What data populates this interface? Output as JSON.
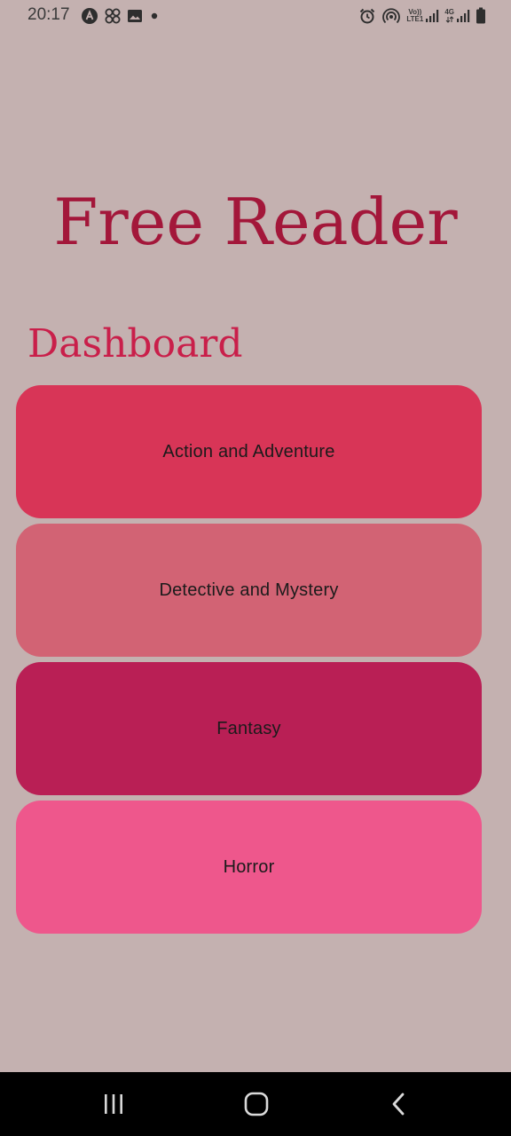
{
  "status_bar": {
    "time": "20:17",
    "left_icons": [
      "auto-icon",
      "grid-app-icon",
      "image-icon",
      "dot-icon"
    ],
    "right_icons": [
      "alarm-icon",
      "hotspot-icon",
      "volte-signal-icon",
      "4g-signal-icon",
      "battery-icon"
    ],
    "volte_label_1": "Vo))",
    "volte_label_2": "LTE1",
    "net_label": "4G"
  },
  "app": {
    "title": "Free Reader"
  },
  "dashboard": {
    "heading": "Dashboard",
    "categories": [
      {
        "label": "Action and Adventure",
        "color": "#d83557"
      },
      {
        "label": "Detective and Mystery",
        "color": "#d26374"
      },
      {
        "label": "Fantasy",
        "color": "#b91f55"
      },
      {
        "label": "Horror",
        "color": "#ee578c"
      }
    ]
  },
  "colors": {
    "background": "#c4b1b0",
    "title": "#a3173a",
    "heading": "#c91f4a",
    "nav_bar": "#000000"
  },
  "nav_bar": {
    "icons": [
      "recent-apps-icon",
      "home-icon",
      "back-icon"
    ]
  }
}
